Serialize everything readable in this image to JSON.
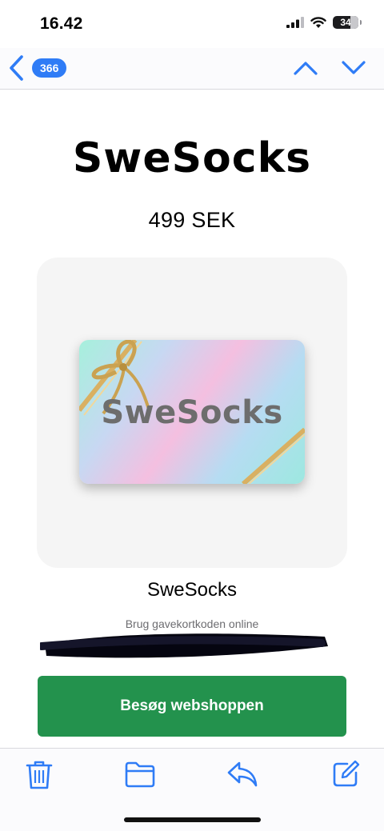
{
  "status_bar": {
    "time": "16.42",
    "battery_level": "34",
    "icons": [
      "signal-icon",
      "wifi-icon",
      "battery-icon"
    ]
  },
  "nav": {
    "back_icon": "chevron-left-icon",
    "unread_count": "366",
    "prev_icon": "chevron-up-icon",
    "next_icon": "chevron-down-icon",
    "accent_color": "#2f7cf6"
  },
  "email": {
    "brand_title": "SweSocks",
    "price": "499 SEK",
    "gift_card_text": "SweSocks",
    "merchant_name": "SweSocks",
    "code_label": "Brug gavekortkoden online",
    "code_value_redacted": true,
    "visit_button_label": "Besøg webshoppen",
    "button_color": "#23924d"
  },
  "toolbar": {
    "icons": [
      "trash-icon",
      "folder-icon",
      "reply-icon",
      "compose-icon"
    ]
  }
}
